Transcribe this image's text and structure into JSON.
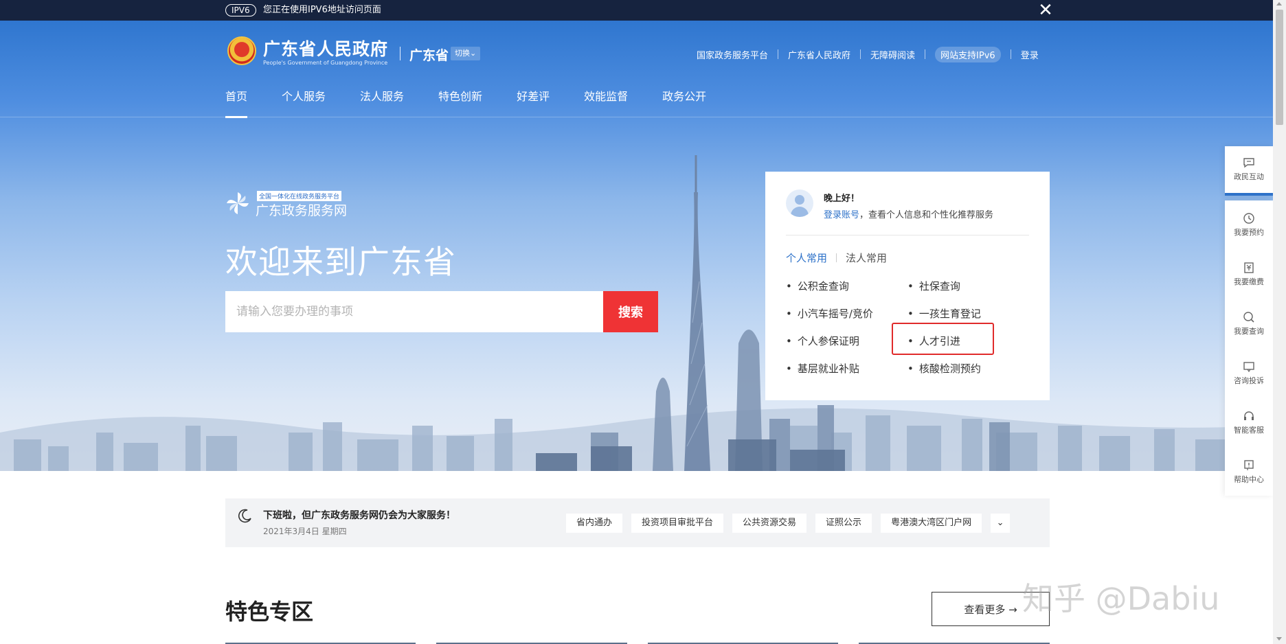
{
  "ipv6_bar": {
    "badge": "IPV6",
    "text": "您正在使用IPV6地址访问页面",
    "close_glyph": "✕"
  },
  "header": {
    "site_name": "广东省人民政府",
    "site_name_en": "People's Government of Guangdong Province",
    "province": "广东省",
    "switch_label": "切换⌄",
    "top_links": [
      "国家政务服务平台",
      "广东省人民政府",
      "无障碍阅读",
      "网站支持IPv6",
      "登录"
    ]
  },
  "nav": {
    "items": [
      "首页",
      "个人服务",
      "法人服务",
      "特色创新",
      "好差评",
      "效能监督",
      "政务公开"
    ],
    "active_index": 0
  },
  "hero": {
    "platform_tag": "全国一体化在线政务服务平台",
    "platform_name": "广东政务服务网",
    "welcome": "欢迎来到广东省",
    "search_placeholder": "请输入您要办理的事项",
    "search_button": "搜索"
  },
  "user_card": {
    "greeting": "晚上好！",
    "login_link": "登录账号",
    "login_suffix": "，查看个人信息和个性化推荐服务",
    "tabs": [
      "个人常用",
      "法人常用"
    ],
    "active_tab": 0,
    "quick_left": [
      "公积金查询",
      "小汽车摇号/竞价",
      "个人参保证明",
      "基层就业补贴"
    ],
    "quick_right": [
      "社保查询",
      "一孩生育登记",
      "人才引进",
      "核酸检测预约"
    ]
  },
  "notice": {
    "title": "下班啦，但广东政务服务网仍会为大家服务！",
    "date": "2021年3月4日 星期四",
    "chips": [
      "省内通办",
      "投资项目审批平台",
      "公共资源交易",
      "证照公示",
      "粤港澳大湾区门户网"
    ],
    "more_glyph": "⌄"
  },
  "featured": {
    "title": "特色专区",
    "more_button": "查看更多 →"
  },
  "side_toolbar": {
    "items": [
      "政民互动",
      "我要预约",
      "我要缴费",
      "我要查询",
      "咨询投诉",
      "智能客服",
      "帮助中心"
    ]
  },
  "watermark": "知乎 @Dabiu",
  "colors": {
    "top_bar": "#16233f",
    "hero_blue": "#2f76cf",
    "search_red": "#ef3335",
    "link_blue": "#2e72c9",
    "highlight_red": "#e02a2a"
  }
}
